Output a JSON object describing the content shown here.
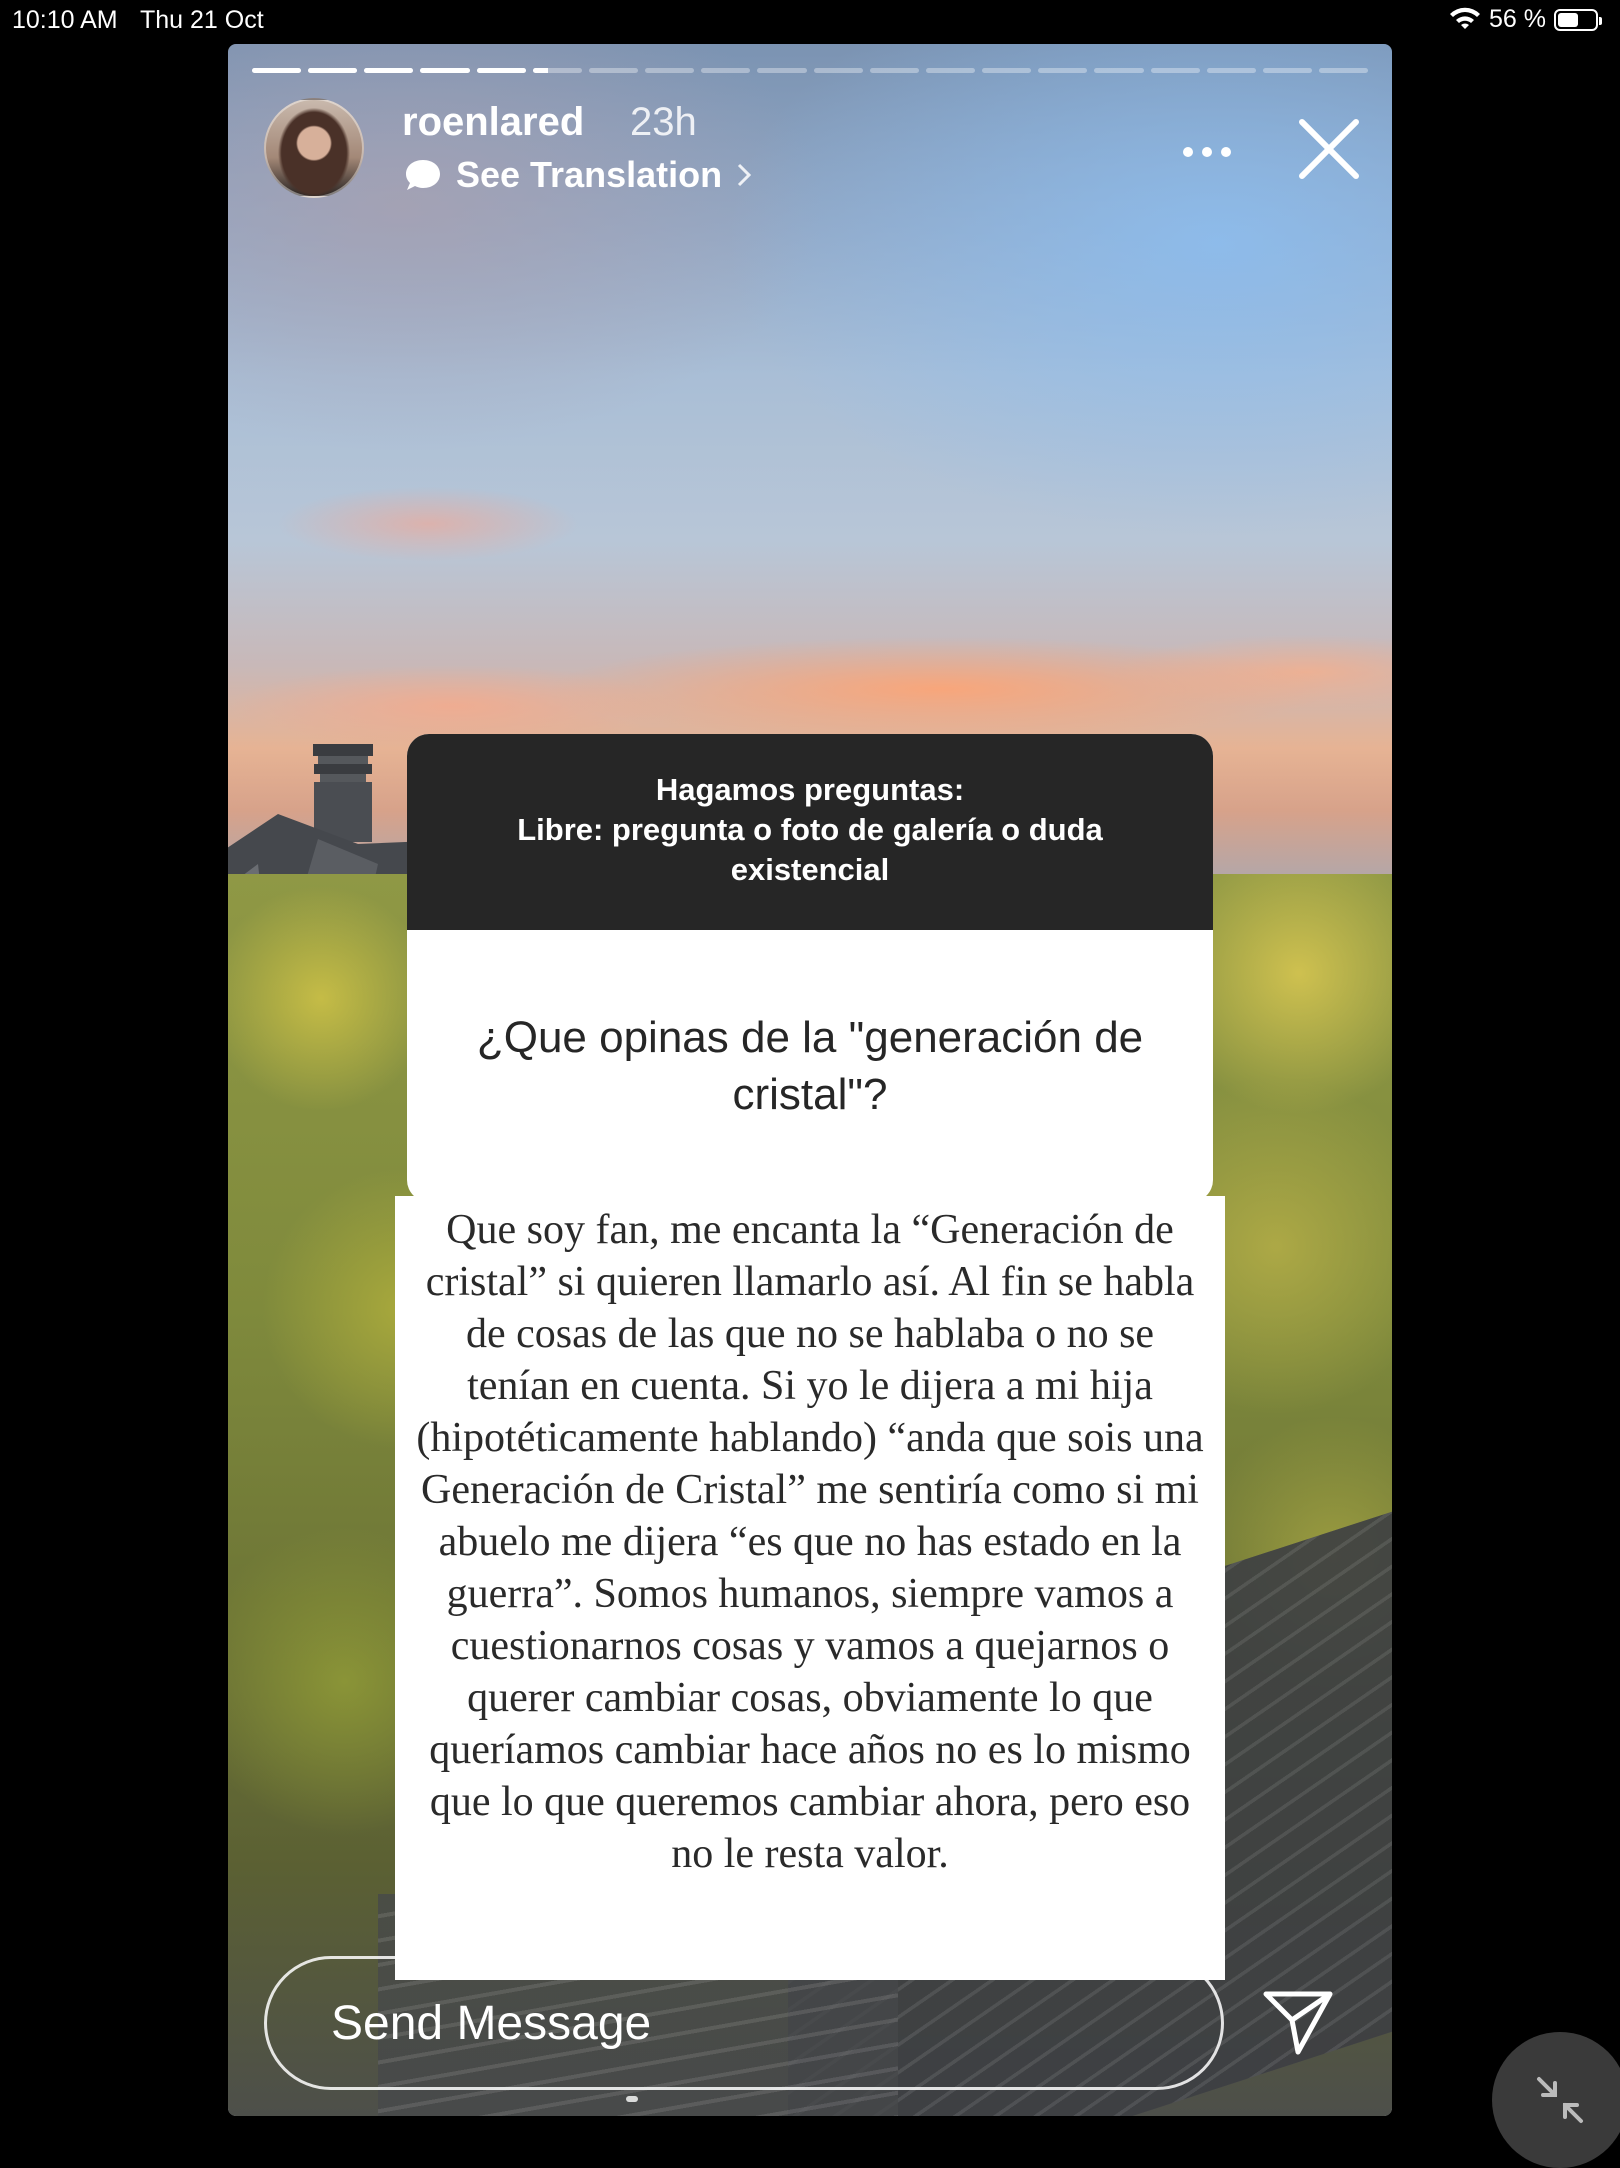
{
  "status_bar": {
    "time": "10:10 AM",
    "date": "Thu 21 Oct",
    "battery": "56 %",
    "battery_level": 0.56,
    "icons": [
      "wifi-icon",
      "battery-icon"
    ]
  },
  "story": {
    "progress": {
      "segments": 20,
      "completed": 5,
      "current_fill": 0.3
    },
    "username": "roenlared",
    "time_ago": "23h",
    "see_translation": "See Translation",
    "icons": [
      "more-icon",
      "close-icon",
      "speech-bubble-icon",
      "chevron-right-icon",
      "send-icon",
      "minimize-icon"
    ]
  },
  "question_card": {
    "header": "Hagamos preguntas:\nLibre: pregunta o foto de galería o duda existencial",
    "question": "¿Que opinas de la \"generación de cristal\"?"
  },
  "answer": {
    "text": "Que soy fan, me encanta la “Generación de cristal” si quieren llamarlo así. Al fin se habla de cosas de las que no se hablaba o no se tenían en cuenta. Si yo le dijera a mi hija (hipotéticamente hablando) “anda que sois una Generación de Cristal” me sentiría como si mi abuelo me dijera “es que no has estado en la guerra”. Somos humanos, siempre vamos a cuestionarnos cosas y vamos a quejarnos o querer cambiar cosas, obviamente lo que queríamos cambiar hace años no es lo mismo que lo que queremos cambiar ahora, pero eso no le resta valor."
  },
  "message_bar": {
    "placeholder": "Send Message"
  },
  "colors": {
    "question_header_bg": "#262626",
    "card_bg": "#ffffff",
    "page_bg": "#000000"
  }
}
